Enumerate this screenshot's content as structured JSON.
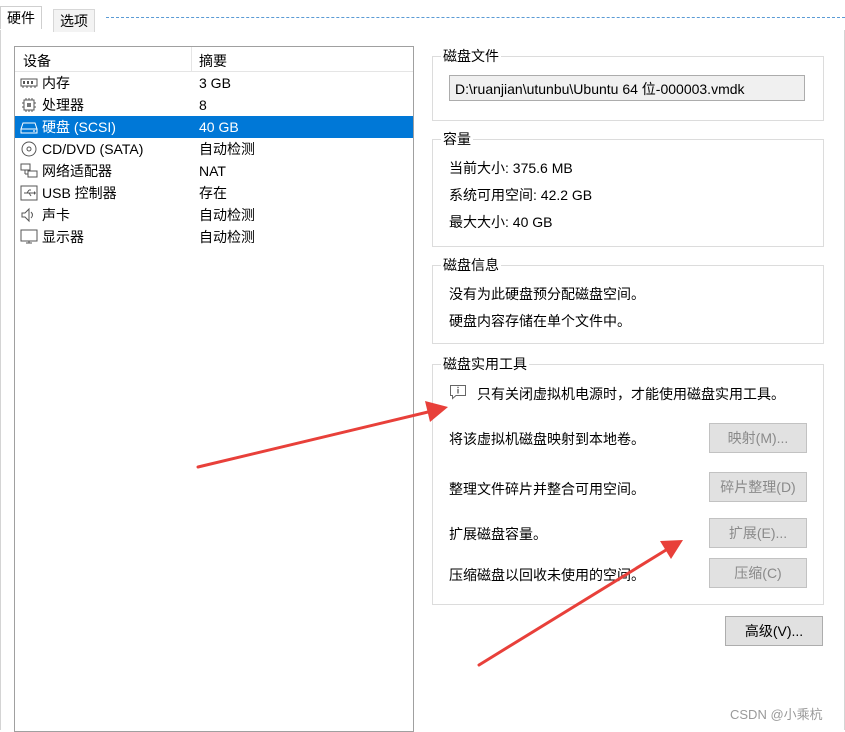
{
  "tabs": {
    "hardware": "硬件",
    "options": "选项"
  },
  "device_list": {
    "col_device": "设备",
    "col_summary": "摘要",
    "items": [
      {
        "name": "内存",
        "summary": "3 GB",
        "icon": "memory-icon"
      },
      {
        "name": "处理器",
        "summary": "8",
        "icon": "processor-icon"
      },
      {
        "name": "硬盘 (SCSI)",
        "summary": "40 GB",
        "icon": "hard-disk-icon",
        "selected": true
      },
      {
        "name": "CD/DVD (SATA)",
        "summary": "自动检测",
        "icon": "cd-dvd-icon"
      },
      {
        "name": "网络适配器",
        "summary": "NAT",
        "icon": "network-adapter-icon"
      },
      {
        "name": "USB 控制器",
        "summary": "存在",
        "icon": "usb-icon"
      },
      {
        "name": "声卡",
        "summary": "自动检测",
        "icon": "sound-card-icon"
      },
      {
        "name": "显示器",
        "summary": "自动检测",
        "icon": "display-icon"
      }
    ]
  },
  "disk_file": {
    "title": "磁盘文件",
    "path": "D:\\ruanjian\\utunbu\\Ubuntu 64 位-000003.vmdk"
  },
  "capacity": {
    "title": "容量",
    "current_size": "当前大小: 375.6 MB",
    "available": "系统可用空间: 42.2 GB",
    "max_size": "最大大小: 40 GB"
  },
  "disk_info": {
    "title": "磁盘信息",
    "line1": "没有为此硬盘预分配磁盘空间。",
    "line2": "硬盘内容存储在单个文件中。"
  },
  "disk_utilities": {
    "title": "磁盘实用工具",
    "notice": "只有关闭虚拟机电源时，才能使用磁盘实用工具。",
    "map_desc": "将该虚拟机磁盘映射到本地卷。",
    "map_button": "映射(M)...",
    "defrag_desc": "整理文件碎片并整合可用空间。",
    "defrag_button": "碎片整理(D)",
    "expand_desc": "扩展磁盘容量。",
    "expand_button": "扩展(E)...",
    "compact_desc": "压缩磁盘以回收未使用的空间。",
    "compact_button": "压缩(C)"
  },
  "advanced_button": "高级(V)...",
  "watermark": "CSDN @小乘杭",
  "colors": {
    "selection": "#0078d7",
    "arrow": "#e8403a"
  }
}
